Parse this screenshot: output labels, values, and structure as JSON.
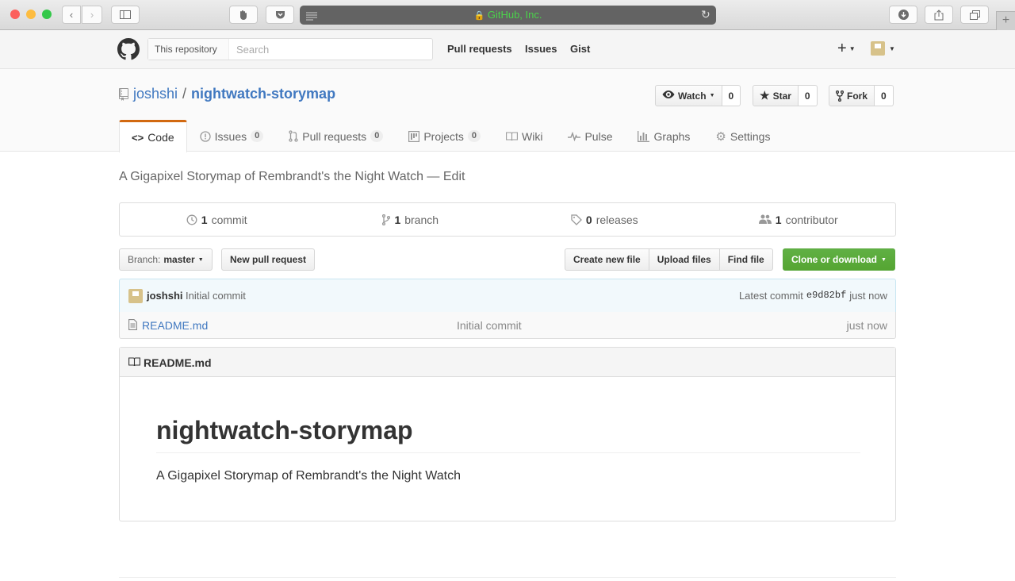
{
  "browser": {
    "url_label": "GitHub, Inc."
  },
  "header": {
    "scope_label": "This repository",
    "search_placeholder": "Search",
    "nav": [
      "Pull requests",
      "Issues",
      "Gist"
    ]
  },
  "repo": {
    "owner": "joshshi",
    "name": "nightwatch-storymap",
    "watch_label": "Watch",
    "watch_count": "0",
    "star_label": "Star",
    "star_count": "0",
    "fork_label": "Fork",
    "fork_count": "0"
  },
  "tabs": [
    {
      "label": "Code",
      "icon": "code-icon"
    },
    {
      "label": "Issues",
      "count": "0",
      "icon": "issue-icon"
    },
    {
      "label": "Pull requests",
      "count": "0",
      "icon": "pull-request-icon"
    },
    {
      "label": "Projects",
      "count": "0",
      "icon": "project-icon"
    },
    {
      "label": "Wiki",
      "icon": "book-icon"
    },
    {
      "label": "Pulse",
      "icon": "pulse-icon"
    },
    {
      "label": "Graphs",
      "icon": "graph-icon"
    },
    {
      "label": "Settings",
      "icon": "gear-icon"
    }
  ],
  "description": {
    "text": "A Gigapixel Storymap of Rembrandt's the Night Watch",
    "separator": "—",
    "edit_label": "Edit"
  },
  "summary": [
    {
      "count": "1",
      "label": "commit",
      "icon": "history-icon"
    },
    {
      "count": "1",
      "label": "branch",
      "icon": "branch-icon"
    },
    {
      "count": "0",
      "label": "releases",
      "icon": "tag-icon"
    },
    {
      "count": "1",
      "label": "contributor",
      "icon": "people-icon"
    }
  ],
  "file_nav": {
    "branch_prefix": "Branch:",
    "branch": "master",
    "new_pr": "New pull request",
    "create_file": "Create new file",
    "upload_files": "Upload files",
    "find_file": "Find file",
    "clone": "Clone or download"
  },
  "commit": {
    "author": "joshshi",
    "message": "Initial commit",
    "latest_label": "Latest commit",
    "sha": "e9d82bf",
    "time": "just now"
  },
  "files": [
    {
      "name": "README.md",
      "message": "Initial commit",
      "age": "just now"
    }
  ],
  "readme": {
    "header": "README.md",
    "title": "nightwatch-storymap",
    "body": "A Gigapixel Storymap of Rembrandt's the Night Watch"
  },
  "colors": {
    "link": "#4078c0",
    "tab_accent": "#d26911",
    "green_button": "#55a532",
    "avatar": "#d7c28a"
  }
}
